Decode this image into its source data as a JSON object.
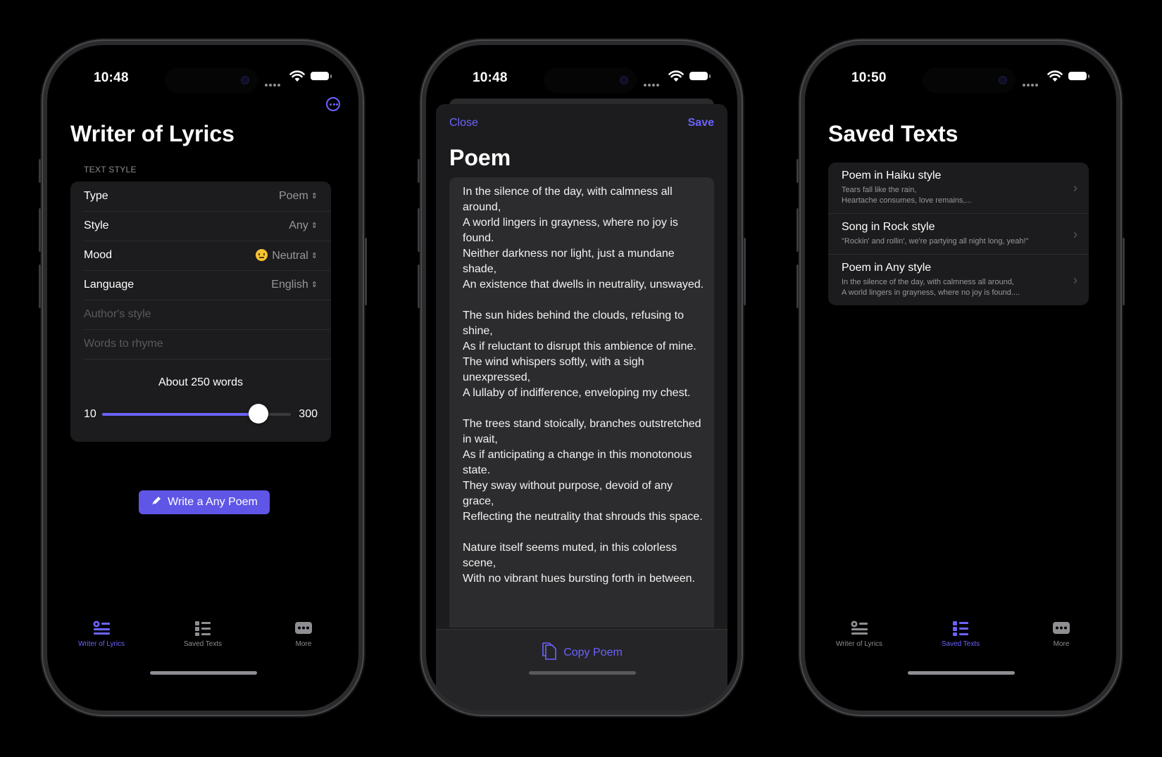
{
  "colors": {
    "accent": "#6c63ff",
    "background": "#000000",
    "card": "#1c1c1e"
  },
  "phone1": {
    "status_time": "10:48",
    "title": "Writer of Lyrics",
    "section_label": "TEXT STYLE",
    "rows": [
      {
        "label": "Type",
        "value": "Poem"
      },
      {
        "label": "Style",
        "value": "Any"
      },
      {
        "label": "Mood",
        "value": "Neutral"
      },
      {
        "label": "Language",
        "value": "English"
      }
    ],
    "author_placeholder": "Author's style",
    "rhyme_placeholder": "Words to rhyme",
    "word_count_label": "About 250 words",
    "slider": {
      "min": "10",
      "max": "300",
      "value_fraction": 0.83
    },
    "write_button": "Write a Any Poem",
    "tabs": [
      "Writer of Lyrics",
      "Saved Texts",
      "More"
    ]
  },
  "phone2": {
    "status_time": "10:48",
    "close": "Close",
    "save": "Save",
    "title": "Poem",
    "poem": "In the silence of the day, with calmness all around,\nA world lingers in grayness, where no joy is found.\nNeither darkness nor light, just a mundane shade,\nAn existence that dwells in neutrality, unswayed.\n\nThe sun hides behind the clouds, refusing to shine,\nAs if reluctant to disrupt this ambience of mine.\nThe wind whispers softly, with a sigh unexpressed,\nA lullaby of indifference, enveloping my chest.\n\nThe trees stand stoically, branches outstretched in wait,\nAs if anticipating a change in this monotonous state.\nThey sway without purpose, devoid of any grace,\nReflecting the neutrality that shrouds this space.\n\nNature itself seems muted, in this colorless scene,\nWith no vibrant hues bursting forth in between.",
    "copy_button": "Copy Poem"
  },
  "phone3": {
    "status_time": "10:50",
    "title": "Saved Texts",
    "items": [
      {
        "title": "Poem  in Haiku style",
        "subtitle": "Tears fall like the rain,\nHeartache consumes, love remains,..."
      },
      {
        "title": "Song  in Rock style",
        "subtitle": "\"Rockin' and rollin', we're partying all night long, yeah!\""
      },
      {
        "title": "Poem  in Any style",
        "subtitle": "In the silence of the day, with calmness all around,\nA world lingers in grayness, where no joy is found...."
      }
    ],
    "tabs": [
      "Writer of Lyrics",
      "Saved Texts",
      "More"
    ]
  }
}
